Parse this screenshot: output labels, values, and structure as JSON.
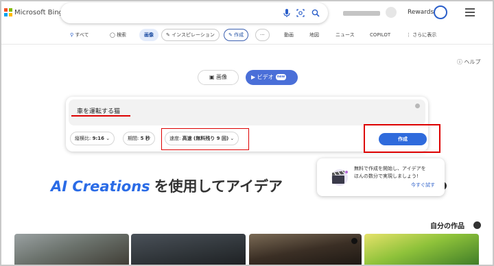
{
  "app": {
    "brand": "Microsoft Bing",
    "rewards": "Rewards"
  },
  "tabs": {
    "all": "すべて",
    "search": "検索",
    "images": "画像",
    "inspiration": "インスピレーション",
    "create": "作成",
    "more_dots": "···",
    "video": "動画",
    "map": "地図",
    "news": "ニュース",
    "copilot": "COPILOT",
    "more_show": "さらに表示"
  },
  "help": "ヘルプ",
  "mode": {
    "image": "画像",
    "video": "ビデオ",
    "new_badge": "new"
  },
  "prompt": {
    "value": "車を運転する猫"
  },
  "options": {
    "aspect_label": "縦横比: ",
    "aspect_value": "9:16",
    "duration_label": "期間: ",
    "duration_value": "5 秒",
    "speed_label": "速度: ",
    "speed_value": "高速 (無料残り 9 回)"
  },
  "create_button": "作成",
  "hero": {
    "highlight": "AI Creations",
    "rest": "を使用してアイデア"
  },
  "tooltip": {
    "line1": "無料で作成を開始し、アイデアを",
    "line2": "ほんの数分で実現しましょう!",
    "link": "今すぐ試す"
  },
  "my_works": "自分の作品",
  "colors": {
    "accent": "#2f6bdc",
    "highlight_box": "#dd0000",
    "ms_red": "#f25022",
    "ms_green": "#7fba00",
    "ms_blue": "#00a4ef",
    "ms_yellow": "#ffb900"
  }
}
